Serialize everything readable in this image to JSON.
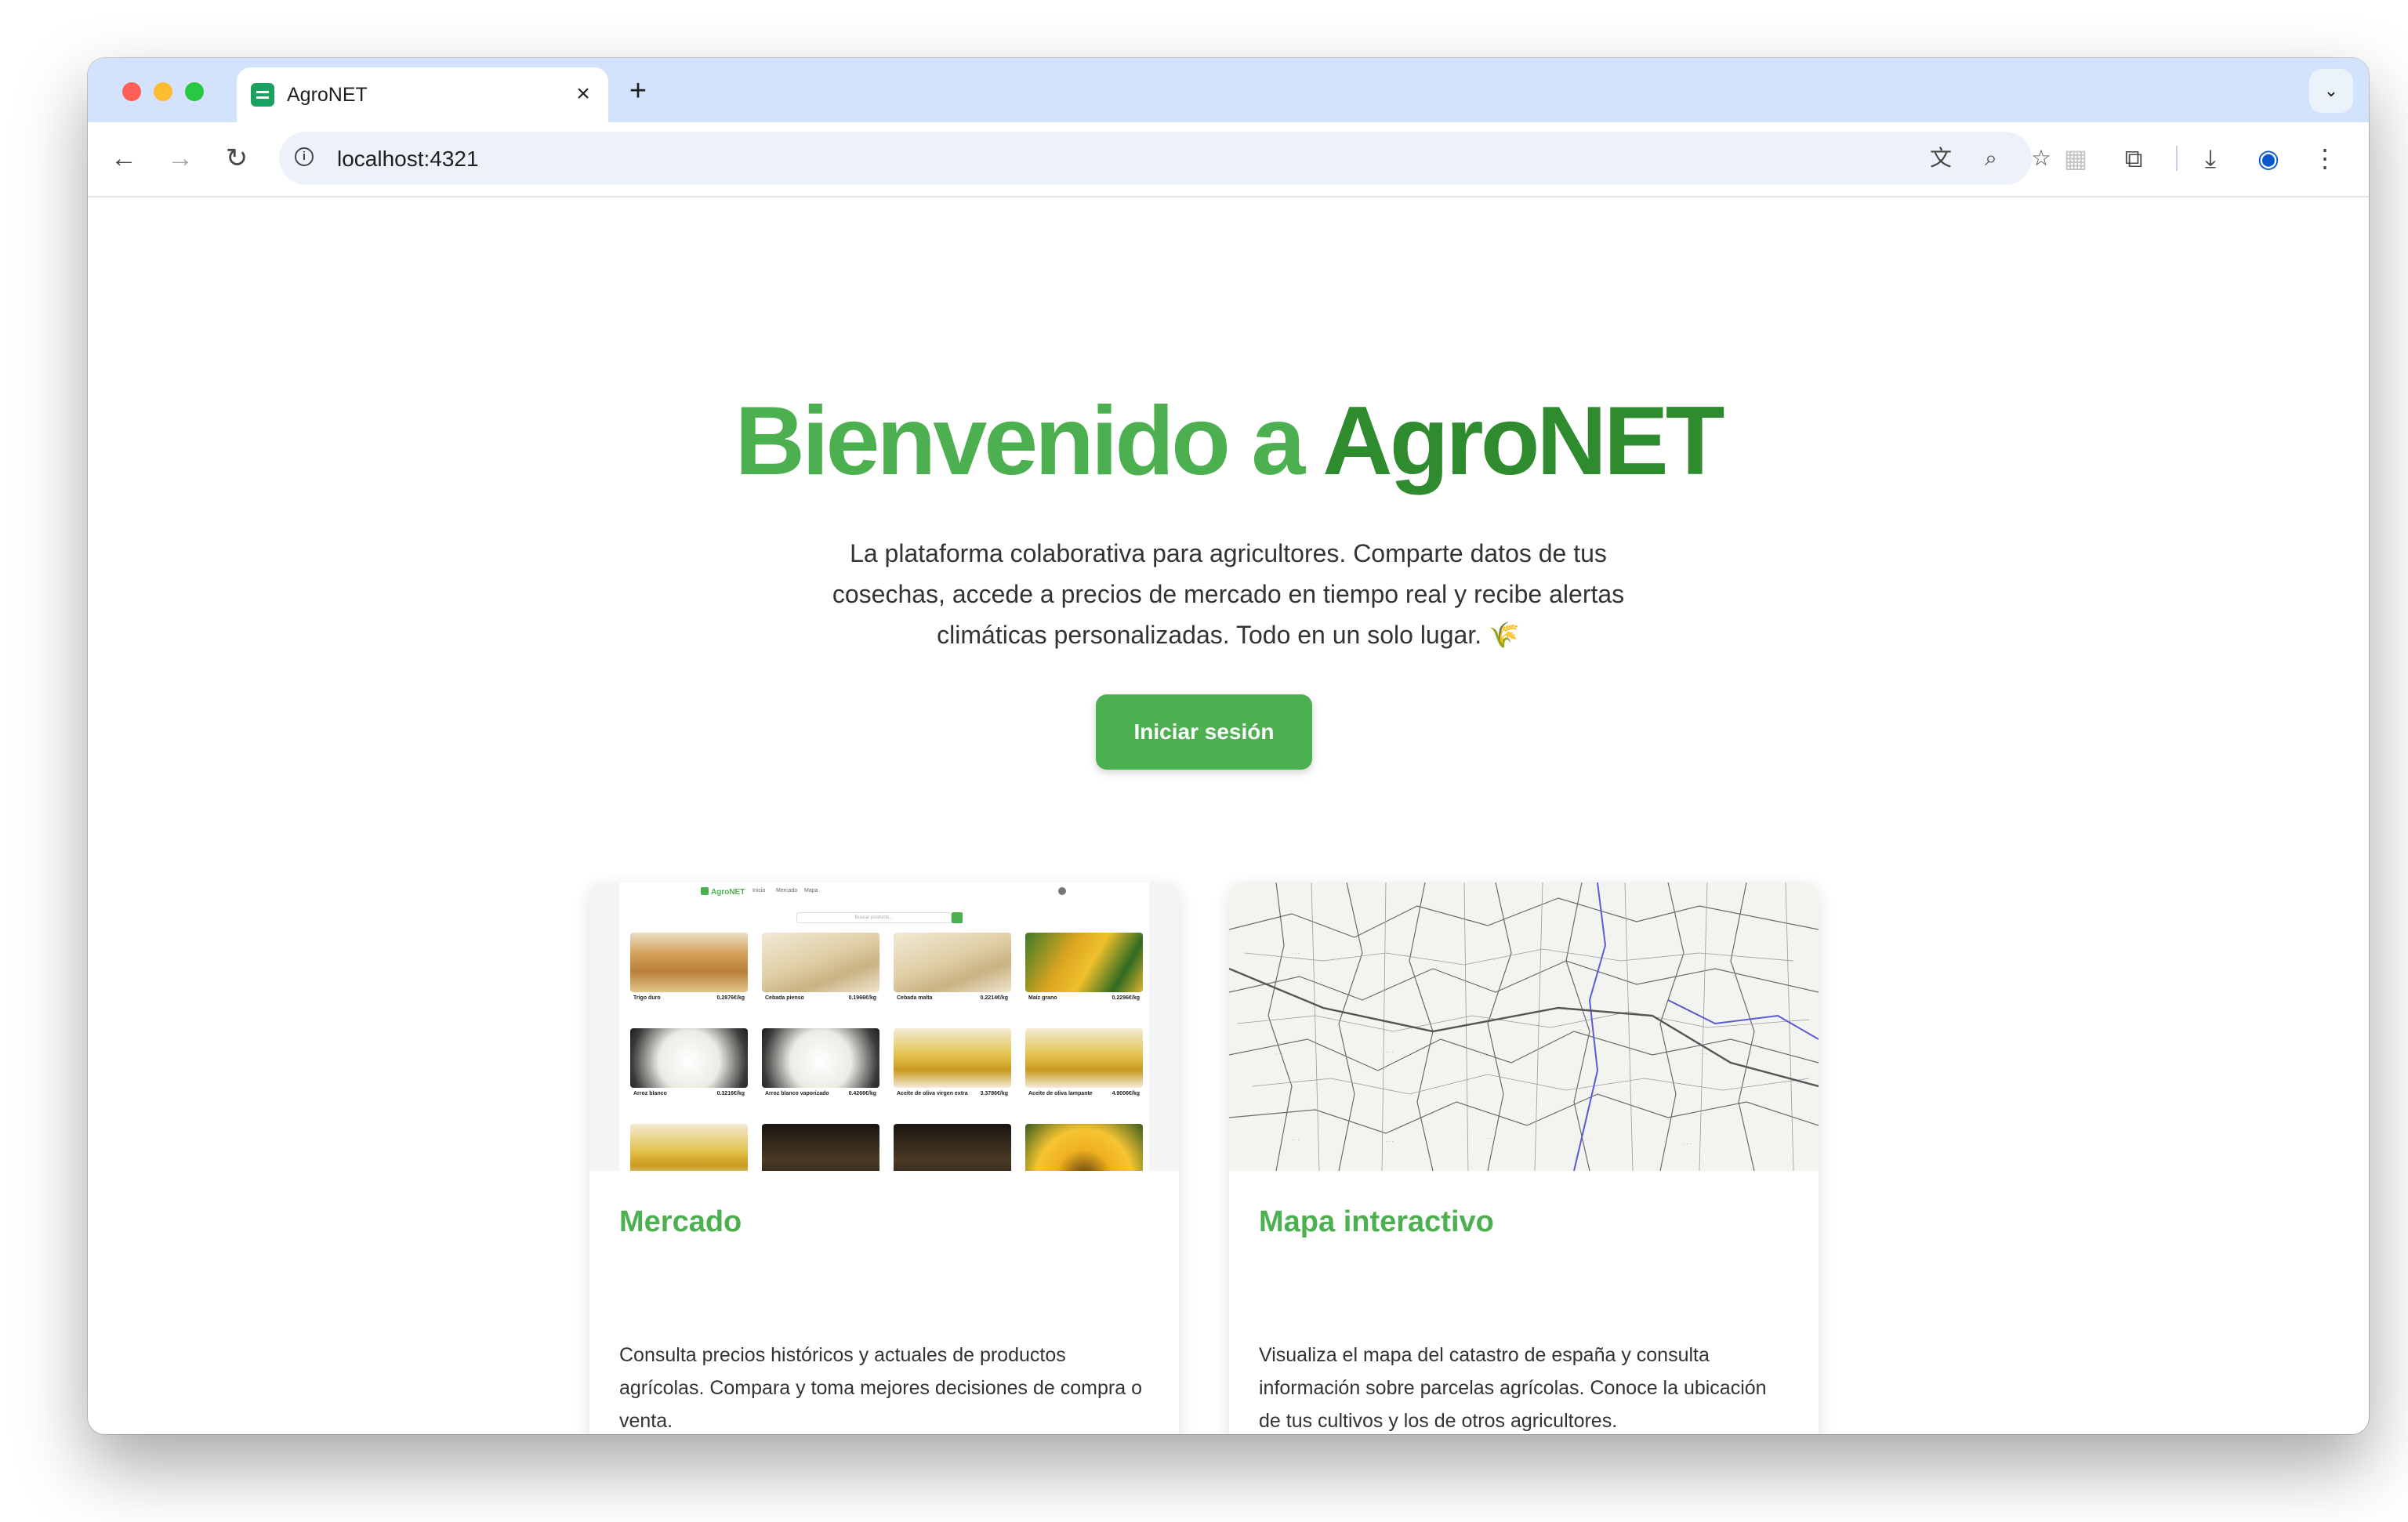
{
  "browser": {
    "tab_title": "AgroNET",
    "tab_close": "×",
    "new_tab": "+",
    "url": "localhost:4321"
  },
  "hero": {
    "title_part1": "Bienvenido a ",
    "title_part2": "AgroNET",
    "subtitle": "La plataforma colaborativa para agricultores. Comparte datos de tus cosechas, accede a precios de mercado en tiempo real y recibe alertas climáticas personalizadas. Todo en un solo lugar. 🌾",
    "cta_label": "Iniciar sesión"
  },
  "cards": [
    {
      "title": "Mercado",
      "text": "Consulta precios históricos y actuales de productos agrícolas. Compara y toma mejores decisiones de compra o venta."
    },
    {
      "title": "Mapa interactivo",
      "text": "Visualiza el mapa del catastro de españa y consulta información sobre parcelas agrícolas. Conoce la ubicación de tus cultivos y los de otros agricultores."
    }
  ],
  "mercado_preview": {
    "logo": "AgroNET",
    "nav": [
      "Inicio",
      "Mercado",
      "Mapa"
    ],
    "search_placeholder": "Buscar producto...",
    "products": [
      {
        "name": "Trigo duro",
        "price": "0.2876€/kg",
        "pic": "wheat"
      },
      {
        "name": "Cebada pienso",
        "price": "0.1966€/kg",
        "pic": "barley"
      },
      {
        "name": "Cebada malta",
        "price": "0.2214€/kg",
        "pic": "barley"
      },
      {
        "name": "Maíz grano",
        "price": "0.2296€/kg",
        "pic": "corn"
      },
      {
        "name": "Arroz blanco",
        "price": "0.3216€/kg",
        "pic": "rice"
      },
      {
        "name": "Arroz blanco vaporizado",
        "price": "0.4266€/kg",
        "pic": "rice"
      },
      {
        "name": "Aceite de oliva virgen extra",
        "price": "3.3786€/kg",
        "pic": "oil"
      },
      {
        "name": "Aceite de oliva lampante",
        "price": "4.9006€/kg",
        "pic": "oil"
      },
      {
        "name": "",
        "price": "",
        "pic": "oil"
      },
      {
        "name": "",
        "price": "",
        "pic": "dark"
      },
      {
        "name": "",
        "price": "",
        "pic": "dark"
      },
      {
        "name": "",
        "price": "",
        "pic": "sun"
      }
    ]
  },
  "icons": {
    "back": "back-arrow-icon",
    "forward": "forward-arrow-icon",
    "reload": "reload-icon",
    "info": "info-icon",
    "translate": "translate-icon",
    "zoom": "zoom-icon",
    "bookmark": "star-icon",
    "extensions": "puzzle-icon",
    "download": "download-icon",
    "profile": "profile-icon",
    "menu": "kebab-menu-icon"
  },
  "colors": {
    "brand_green": "#4caf50",
    "brand_dark_green": "#2e8b2e",
    "tabbar": "#d3e3fd"
  }
}
